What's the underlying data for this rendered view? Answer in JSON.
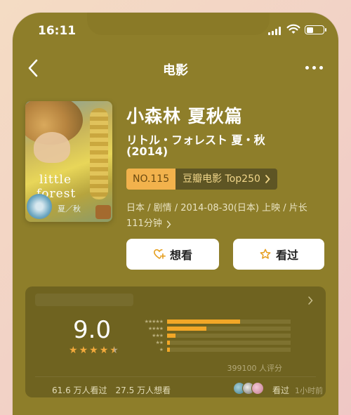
{
  "status_bar": {
    "time": "16:11"
  },
  "nav": {
    "title": "电影"
  },
  "movie": {
    "title_cn": "小森林 夏秋篇",
    "title_orig": "リトル・フォレスト 夏・秋",
    "year": "(2014)",
    "poster_text": {
      "line1": "little",
      "line2": "forest",
      "line3": "夏／秋"
    },
    "rank_no": "NO.115",
    "rank_list": "豆瓣电影 Top250",
    "meta_line1": "日本 / 剧情 / 2014-08-30(日本) 上映 / 片长",
    "meta_line2": "111分钟"
  },
  "actions": {
    "want_label": "想看",
    "seen_label": "看过"
  },
  "rating": {
    "score": "9.0",
    "stars": 4.5,
    "distribution": [
      {
        "stars": 5,
        "fraction": 0.59
      },
      {
        "stars": 4,
        "fraction": 0.32
      },
      {
        "stars": 3,
        "fraction": 0.07
      },
      {
        "stars": 2,
        "fraction": 0.015
      },
      {
        "stars": 1,
        "fraction": 0.01
      }
    ],
    "count_text": "399100 人评分"
  },
  "social": {
    "seen_count": "61.6 万人看过",
    "want_count": "27.5 万人想看",
    "friend_action": "看过",
    "friend_time": "1小时前"
  },
  "colors": {
    "accent": "#f3a727",
    "background": "#8e7e2a",
    "card": "#6f6320"
  }
}
